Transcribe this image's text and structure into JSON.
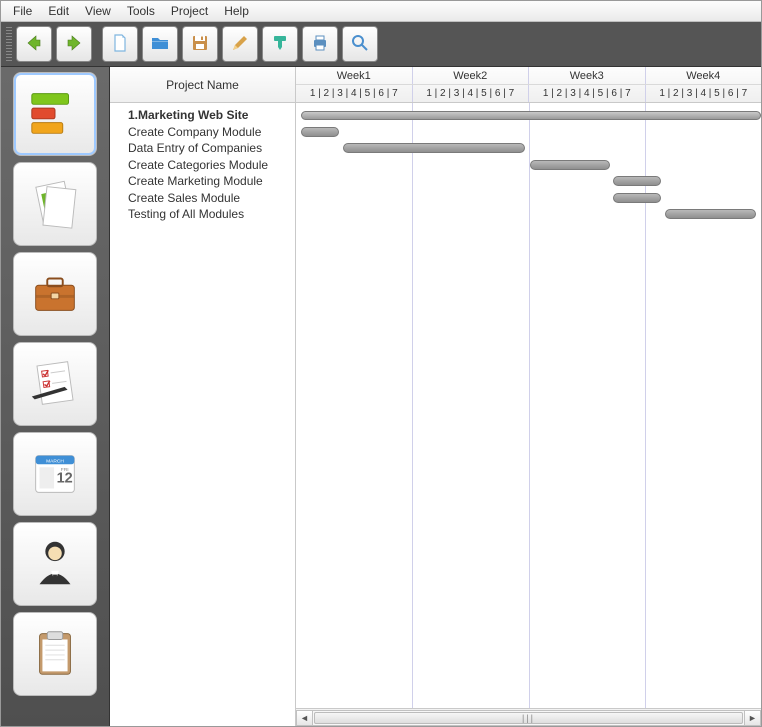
{
  "menu": [
    "File",
    "Edit",
    "View",
    "Tools",
    "Project",
    "Help"
  ],
  "toolbar": [
    {
      "name": "back-button",
      "icon": "arrow-left",
      "color": "#6fb52b"
    },
    {
      "name": "forward-button",
      "icon": "arrow-right",
      "color": "#6fb52b"
    },
    {
      "name": "new-button",
      "icon": "file",
      "color": "#7fb6e0"
    },
    {
      "name": "open-button",
      "icon": "folder",
      "color": "#3f8fd6"
    },
    {
      "name": "save-button",
      "icon": "save",
      "color": "#c98f4a"
    },
    {
      "name": "edit-button",
      "icon": "pencil",
      "color": "#d8a24a"
    },
    {
      "name": "marker-button",
      "icon": "marker",
      "color": "#36b59a"
    },
    {
      "name": "print-button",
      "icon": "printer",
      "color": "#5b8fbf"
    },
    {
      "name": "zoom-button",
      "icon": "search",
      "color": "#4a8fce"
    }
  ],
  "sidebar": [
    {
      "name": "gantt-view",
      "icon": "bars3",
      "active": true
    },
    {
      "name": "reports-view",
      "icon": "sheets"
    },
    {
      "name": "resources-view",
      "icon": "briefcase"
    },
    {
      "name": "tasks-view",
      "icon": "checklist"
    },
    {
      "name": "calendar-view",
      "icon": "calendar",
      "month": "MARCH",
      "day": "12"
    },
    {
      "name": "people-view",
      "icon": "person"
    },
    {
      "name": "clipboard-view",
      "icon": "clipboard"
    }
  ],
  "gantt": {
    "task_column_header": "Project Name",
    "weeks": [
      "Week1",
      "Week2",
      "Week3",
      "Week4"
    ],
    "day_labels": "1 | 2 | 3 | 4 | 5 | 6 | 7",
    "total_days": 28,
    "tasks": [
      {
        "label": "1.Marketing Web Site",
        "project": true,
        "start": 0.3,
        "end": 28
      },
      {
        "label": "Create Company Module",
        "start": 0.3,
        "end": 2.6
      },
      {
        "label": "Data Entry of Companies",
        "start": 2.8,
        "end": 13.8
      },
      {
        "label": "Create Categories Module",
        "start": 14.1,
        "end": 18.9
      },
      {
        "label": "Create Marketing Module",
        "start": 19.1,
        "end": 22
      },
      {
        "label": "Create Sales Module",
        "start": 19.1,
        "end": 22
      },
      {
        "label": "Testing of All Modules",
        "start": 22.2,
        "end": 27.7
      }
    ]
  },
  "chart_data": {
    "type": "gantt",
    "title": "Project Name",
    "x_unit": "days",
    "columns": [
      "Week1",
      "Week2",
      "Week3",
      "Week4"
    ],
    "days_per_column": 7,
    "xlim": [
      0,
      28
    ],
    "series": [
      {
        "name": "1.Marketing Web Site",
        "start": 0,
        "end": 28,
        "summary": true
      },
      {
        "name": "Create Company Module",
        "start": 0,
        "end": 3
      },
      {
        "name": "Data Entry of Companies",
        "start": 3,
        "end": 14
      },
      {
        "name": "Create Categories Module",
        "start": 14,
        "end": 19
      },
      {
        "name": "Create Marketing Module",
        "start": 19,
        "end": 22
      },
      {
        "name": "Create Sales Module",
        "start": 19,
        "end": 22
      },
      {
        "name": "Testing of All Modules",
        "start": 22,
        "end": 28
      }
    ]
  }
}
